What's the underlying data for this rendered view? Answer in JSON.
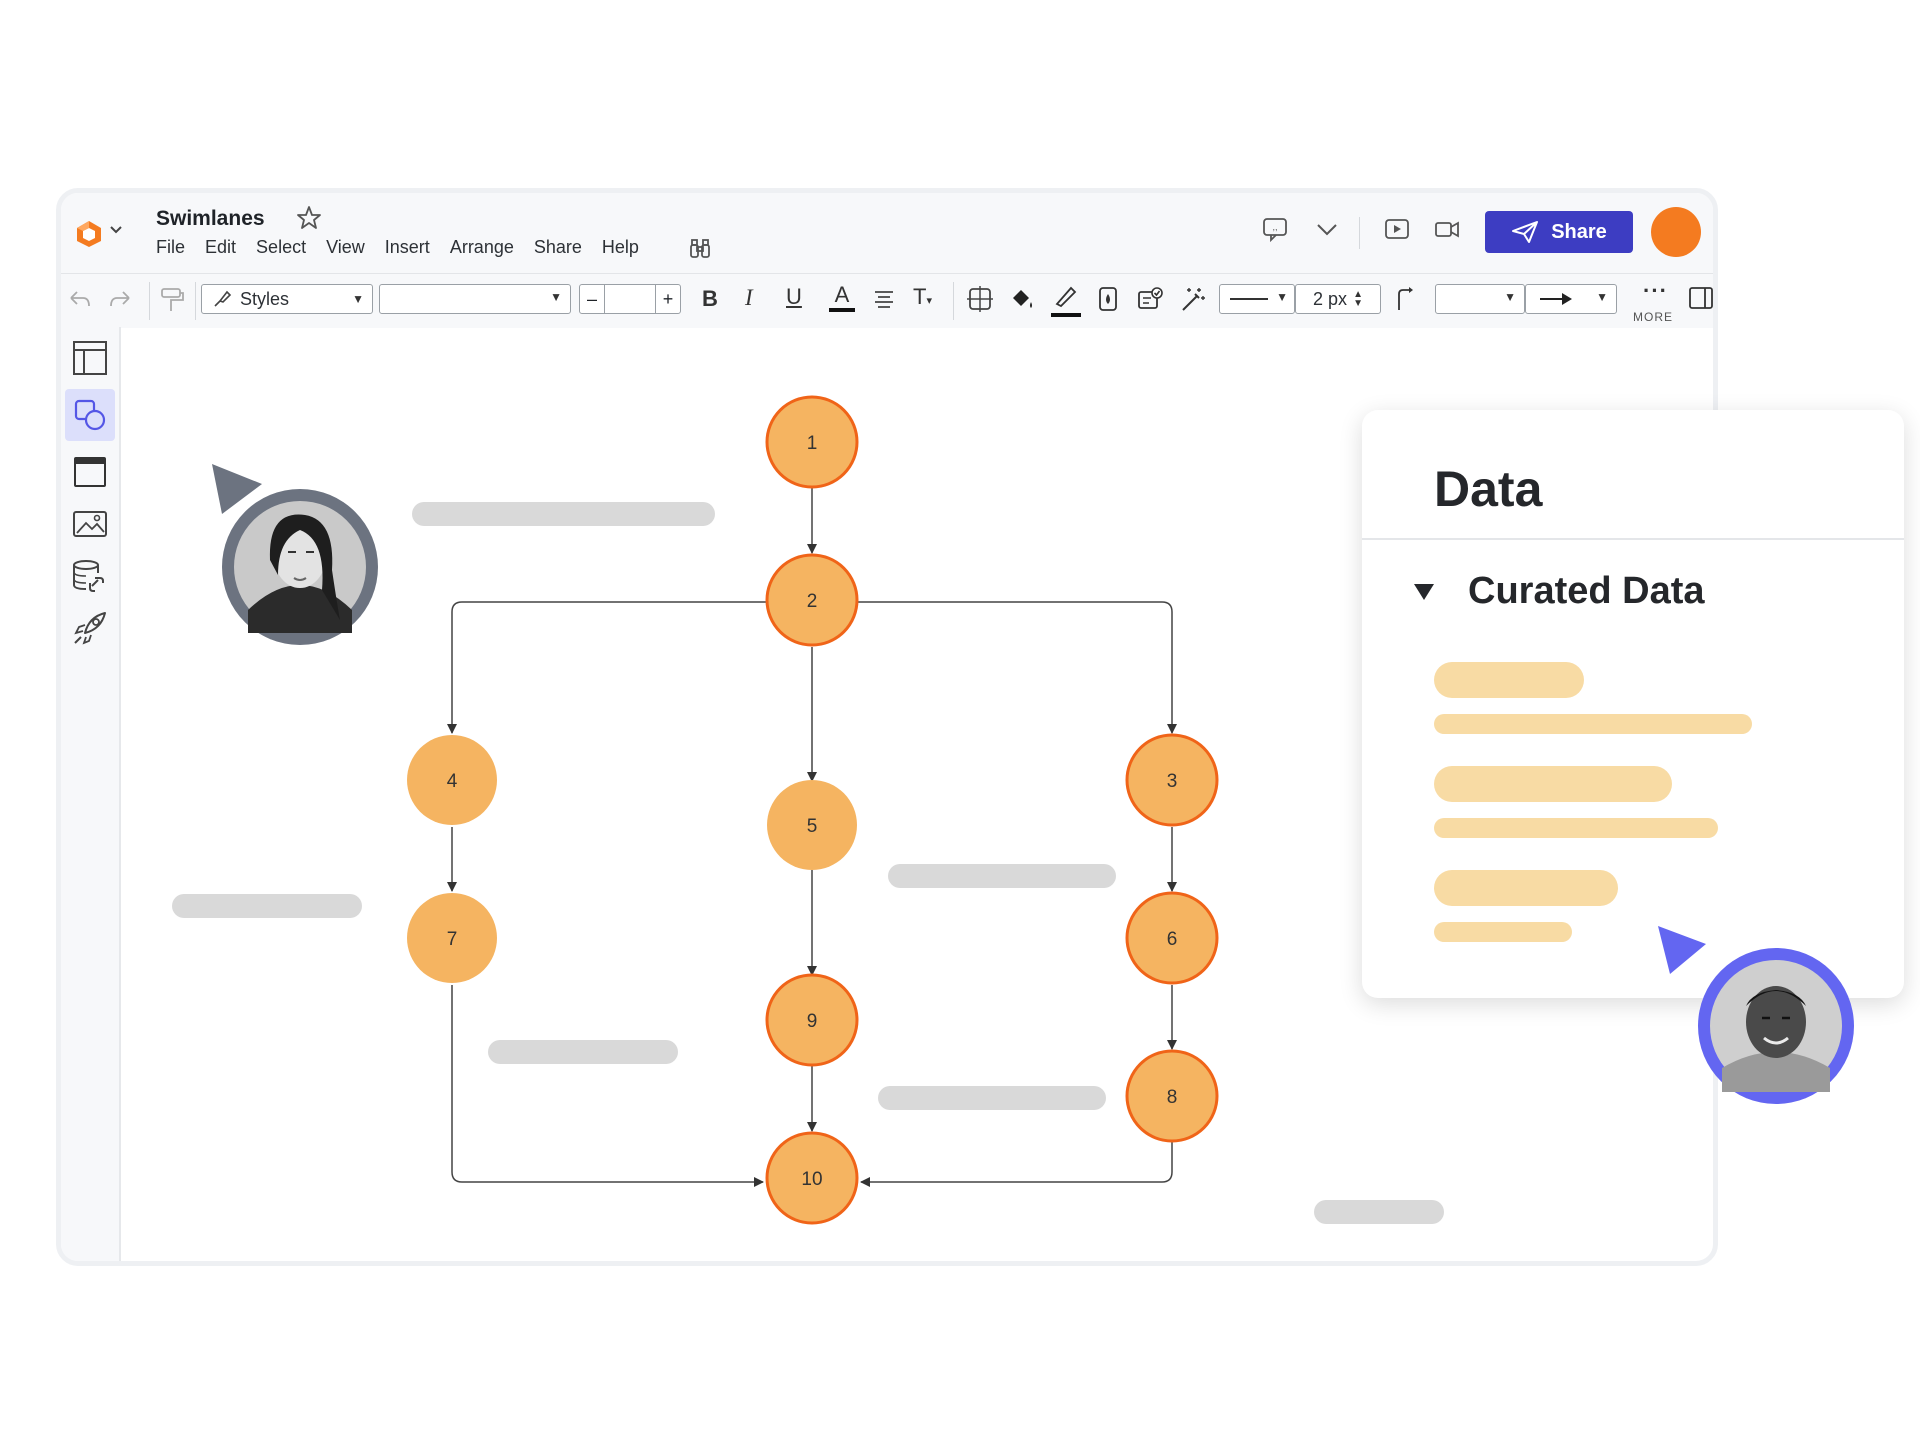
{
  "app": {
    "title": "Swimlanes",
    "menu": [
      "File",
      "Edit",
      "Select",
      "View",
      "Insert",
      "Arrange",
      "Share",
      "Help"
    ]
  },
  "header": {
    "share_label": "Share",
    "accent_color": "#3d3dc2",
    "user_avatar_color": "#f47b20"
  },
  "toolbar": {
    "styles_label": "Styles",
    "font_size_value": "",
    "line_width_value": "2 px",
    "more_label": "MORE"
  },
  "left_sidebar": {
    "items": [
      "layout-icon",
      "shapes-icon",
      "frame-icon",
      "image-icon",
      "data-link-icon",
      "rocket-icon"
    ],
    "active_index": 1
  },
  "diagram": {
    "node_fill": "#f5b461",
    "node_stroke": "#f06418",
    "nodes": [
      "1",
      "2",
      "3",
      "4",
      "5",
      "6",
      "7",
      "8",
      "9",
      "10"
    ],
    "edges": [
      [
        "1",
        "2"
      ],
      [
        "2",
        "4"
      ],
      [
        "2",
        "5"
      ],
      [
        "2",
        "3"
      ],
      [
        "4",
        "7"
      ],
      [
        "5",
        "9"
      ],
      [
        "9",
        "10"
      ],
      [
        "3",
        "6"
      ],
      [
        "6",
        "8"
      ],
      [
        "7",
        "10"
      ],
      [
        "8",
        "10"
      ]
    ]
  },
  "data_panel": {
    "title": "Data",
    "section": "Curated Data"
  },
  "collaborators": [
    {
      "name": "collaborator-woman",
      "ring_color": "#6c7380"
    },
    {
      "name": "collaborator-man",
      "ring_color": "#6366f1"
    }
  ]
}
